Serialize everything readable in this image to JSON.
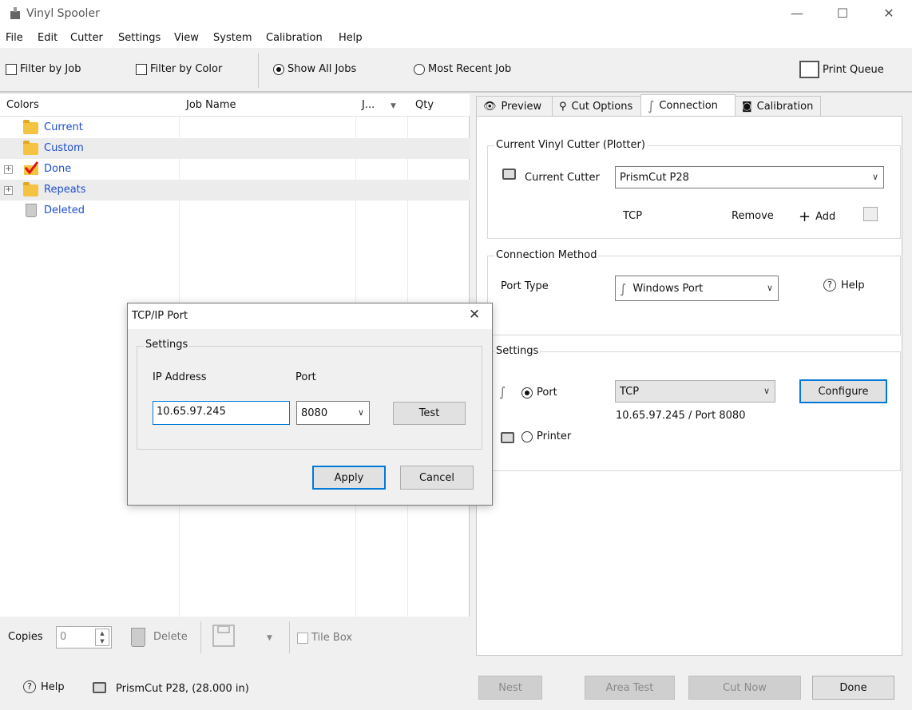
{
  "window": {
    "title": "Vinyl Spooler",
    "minimize": "—",
    "maximize": "☐",
    "close": "✕"
  },
  "menu": [
    "File",
    "Edit",
    "Cutter",
    "Settings",
    "View",
    "System",
    "Calibration",
    "Help"
  ],
  "toolbar": {
    "filter_by_job": "Filter by Job",
    "filter_by_color": "Filter by Color",
    "show_all_jobs": "Show All Jobs",
    "most_recent_job": "Most Recent Job",
    "print_queue": "Print Queue"
  },
  "jobs_table": {
    "columns": [
      "Colors",
      "Job Name",
      "J...",
      "Qty"
    ],
    "rows": [
      "Current",
      "Custom",
      "Done",
      "Repeats",
      "Deleted"
    ]
  },
  "left_bottom": {
    "copies_label": "Copies",
    "copies_value": "0",
    "delete": "Delete",
    "tile_box": "Tile Box"
  },
  "tabs": [
    "Preview",
    "Cut Options",
    "Connection",
    "Calibration"
  ],
  "current_cutter": {
    "group_title": "Current Vinyl Cutter (Plotter)",
    "label": "Current Cutter",
    "value": "PrismCut P28",
    "protocol": "TCP",
    "remove": "Remove",
    "add": "Add"
  },
  "connection_method": {
    "group_title": "Connection Method",
    "port_type_label": "Port Type",
    "port_type_value": "Windows Port",
    "help": "Help"
  },
  "settings": {
    "group_title": "Settings",
    "port_label": "Port",
    "port_value": "TCP",
    "configure": "Configure",
    "address_summary": "10.65.97.245 /  Port 8080",
    "printer_label": "Printer"
  },
  "statusbar": {
    "help": "Help",
    "cutter_info": "PrismCut P28,  (28.000 in)",
    "nest": "Nest",
    "area_test": "Area Test",
    "cut_now": "Cut Now",
    "done": "Done"
  },
  "dialog": {
    "title": "TCP/IP Port",
    "group_title": "Settings",
    "ip_label": "IP Address",
    "port_label": "Port",
    "ip_value": "10.65.97.245",
    "port_value": "8080",
    "test": "Test",
    "apply": "Apply",
    "cancel": "Cancel"
  }
}
